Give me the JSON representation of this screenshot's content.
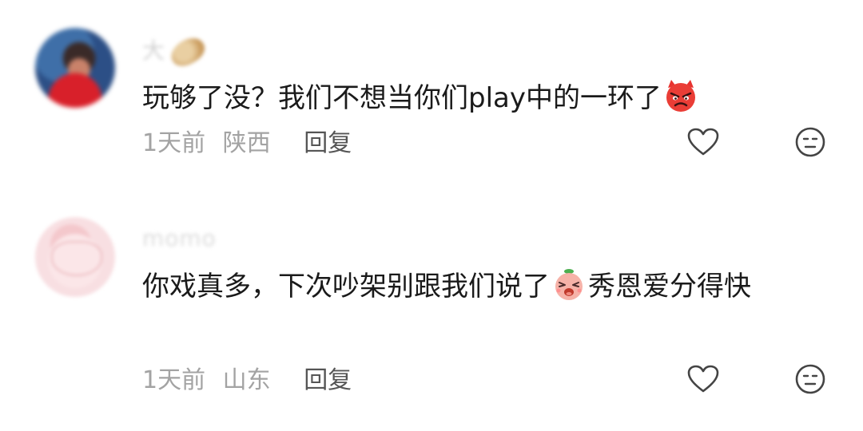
{
  "colors": {
    "text": "#1a1a1a",
    "meta": "#a3a3a3",
    "reply": "#555555",
    "icon": "#444444"
  },
  "comments": [
    {
      "username": "大",
      "text_before_emoji": "玩够了没？我们不想当你们play中的一环了",
      "emoji": "angry-devil-emoji",
      "text_after_emoji": "",
      "time": "1天前",
      "location": "陕西",
      "reply_label": "回复",
      "like_icon": "heart-icon",
      "dislike_icon": "meh-face-icon"
    },
    {
      "username": "momo",
      "text_before_emoji": "你戏真多，下次吵架别跟我们说了",
      "emoji": "crying-peach-emoji",
      "text_after_emoji": "秀恩爱分得快",
      "time": "1天前",
      "location": "山东",
      "reply_label": "回复",
      "like_icon": "heart-icon",
      "dislike_icon": "meh-face-icon"
    }
  ]
}
